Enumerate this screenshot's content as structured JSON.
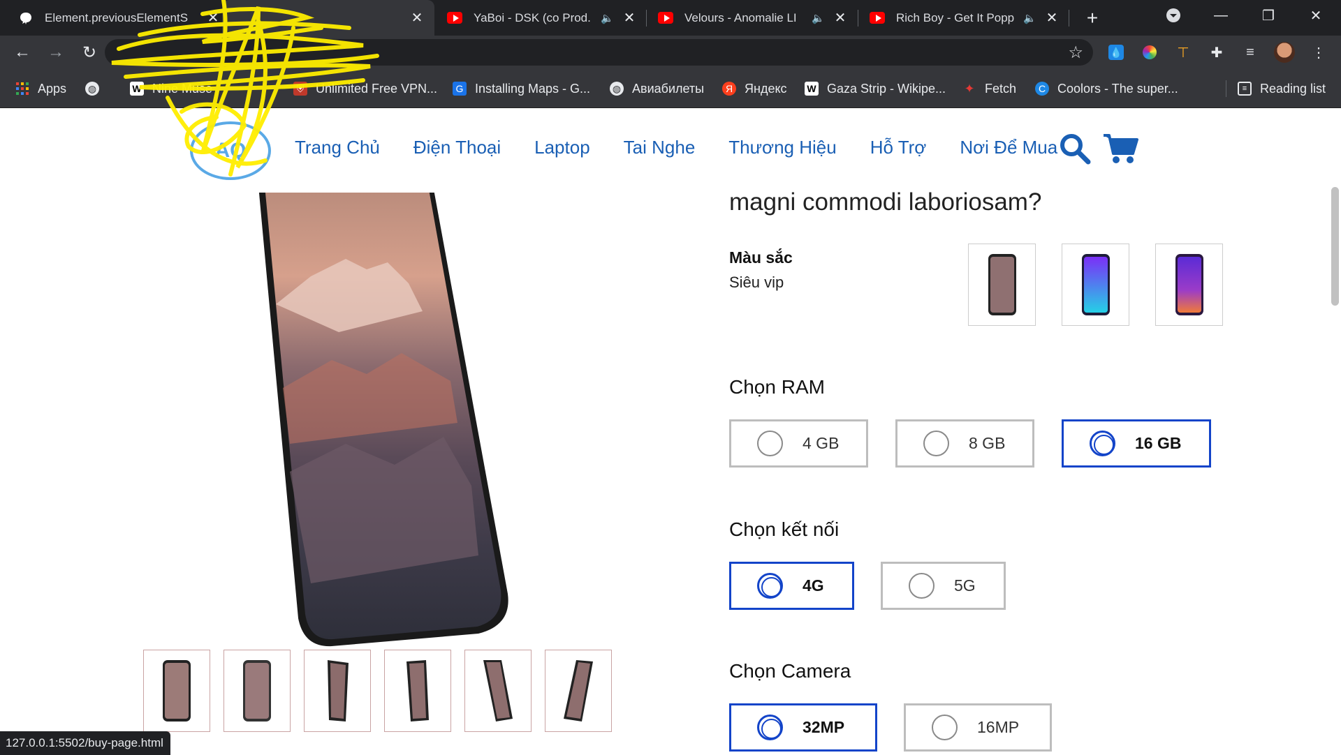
{
  "browser": {
    "tabs": [
      {
        "title": "Element.previousElementS",
        "icon": "github-cat-icon",
        "audio": false
      },
      {
        "title": "",
        "icon": "redacted-icon",
        "audio": false,
        "active": true
      },
      {
        "title": "YaBoi - DSK (co Prod.",
        "icon": "youtube-icon",
        "audio": true
      },
      {
        "title": "Velours - Anomalie LI",
        "icon": "youtube-icon",
        "audio": true
      },
      {
        "title": "Rich Boy - Get It Popp",
        "icon": "youtube-icon",
        "audio": true
      }
    ],
    "new_tab": "+",
    "close_glyph": "✕",
    "url": "",
    "bookmarks": [
      {
        "label": "Apps",
        "icon": "apps-grid-icon"
      },
      {
        "label": "",
        "icon": "globe-icon"
      },
      {
        "label": "Nine Muse",
        "icon": "wiki-icon"
      },
      {
        "label": "Unlimited Free VPN...",
        "icon": "vpn-icon"
      },
      {
        "label": "Installing Maps - G...",
        "icon": "maps-icon"
      },
      {
        "label": "Авиабилеты",
        "icon": "globe-icon"
      },
      {
        "label": "Яндекс",
        "icon": "yandex-icon"
      },
      {
        "label": "Gaza Strip - Wikipe...",
        "icon": "wiki-icon"
      },
      {
        "label": "Fetch",
        "icon": "fetch-icon"
      },
      {
        "label": "Coolors - The super...",
        "icon": "coolors-icon"
      }
    ],
    "reading_list": "Reading list",
    "status_url": "127.0.0.1:5502/buy-page.html"
  },
  "site": {
    "logo_text": "AQ",
    "nav": [
      "Trang Chủ",
      "Điện Thoại",
      "Laptop",
      "Tai Nghe",
      "Thương Hiệu",
      "Hỗ Trợ",
      "Nơi Để Mua"
    ]
  },
  "product": {
    "question": "magni commodi laboriosam?",
    "color_label": "Màu sắc",
    "color_value": "Siêu vip",
    "swatches": [
      "dark-mountain",
      "blue-purple",
      "purple-orange"
    ],
    "thumb_count": 6
  },
  "options": {
    "ram": {
      "title": "Chọn RAM",
      "choices": [
        "4 GB",
        "8 GB",
        "16 GB"
      ],
      "selected": 2
    },
    "connect": {
      "title": "Chọn kết nối",
      "choices": [
        "4G",
        "5G"
      ],
      "selected": 0
    },
    "camera": {
      "title": "Chọn Camera",
      "choices": [
        "32MP",
        "16MP"
      ],
      "selected": 0
    }
  },
  "colors": {
    "accent": "#1344c9",
    "nav": "#1a5fb4",
    "logo": "#5aa9e6"
  }
}
